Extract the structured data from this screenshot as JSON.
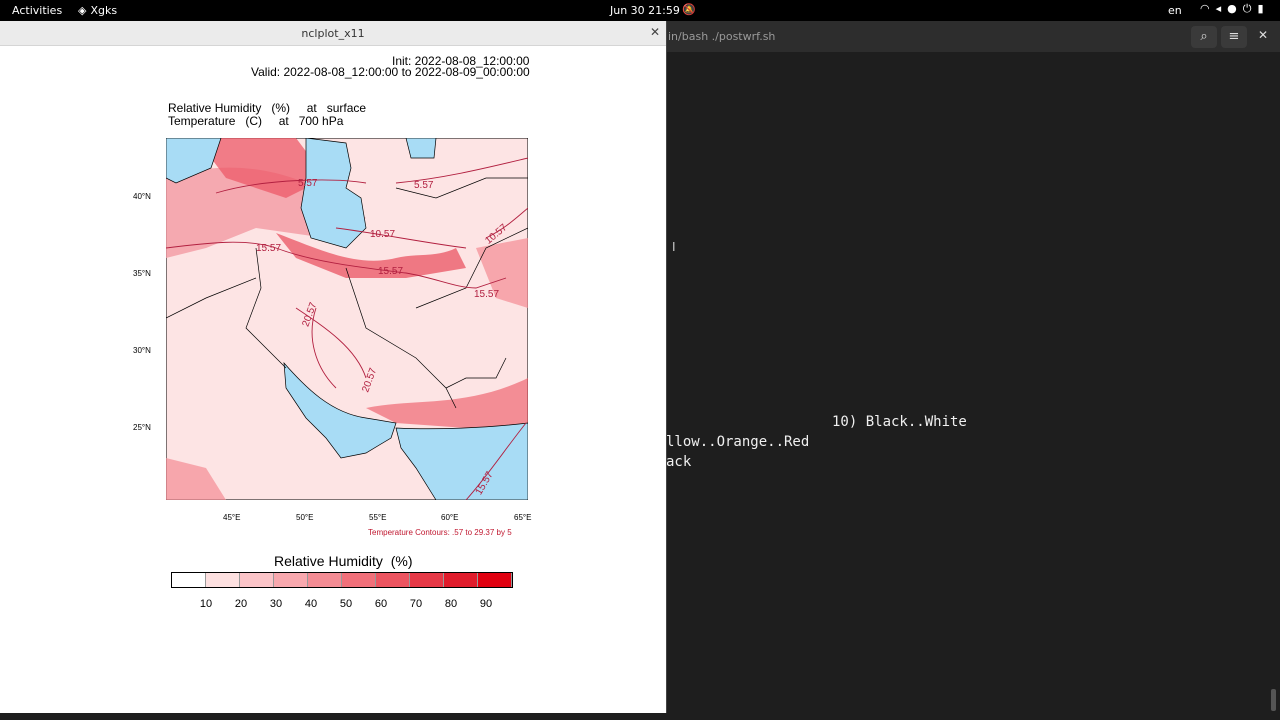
{
  "topbar": {
    "activities": "Activities",
    "app": "Xgks",
    "clock": "Jun 30  21:59",
    "lang": "en"
  },
  "terminal": {
    "title": "in/bash ./postwrf.sh",
    "lines": [
      "10) Black..White",
      "llow..Orange..Red",
      "ack"
    ]
  },
  "plot": {
    "window_title": "nclplot_x11",
    "init": "Init: 2022-08-08_12:00:00",
    "valid": "Valid: 2022-08-08_12:00:00 to 2022-08-09_00:00:00",
    "field1": "Relative Humidity   (%)     at   surface",
    "field2": "Temperature   (C)     at   700 hPa",
    "lat_ticks": [
      "40°N",
      "35°N",
      "30°N",
      "25°N"
    ],
    "lon_ticks": [
      "45°E",
      "50°E",
      "55°E",
      "60°E",
      "65°E"
    ],
    "contour_note": "Temperature Contours: .57 to 29.37 by 5",
    "contour_labels": [
      "5.57",
      "5.57",
      "10.57",
      "10.57",
      "15.57",
      "15.57",
      "15.57",
      "20.57",
      "20.57",
      "15.57"
    ],
    "colorbar_title": "Relative Humidity  (%)",
    "colorbar_labels": [
      "10",
      "20",
      "30",
      "40",
      "50",
      "60",
      "70",
      "80",
      "90"
    ],
    "colorbar_colors": [
      "#ffffff",
      "#fde0e0",
      "#fbc4c8",
      "#f8a8ae",
      "#f48c94",
      "#f1707a",
      "#ec5460",
      "#e63846",
      "#e01c2c",
      "#e00010"
    ]
  }
}
